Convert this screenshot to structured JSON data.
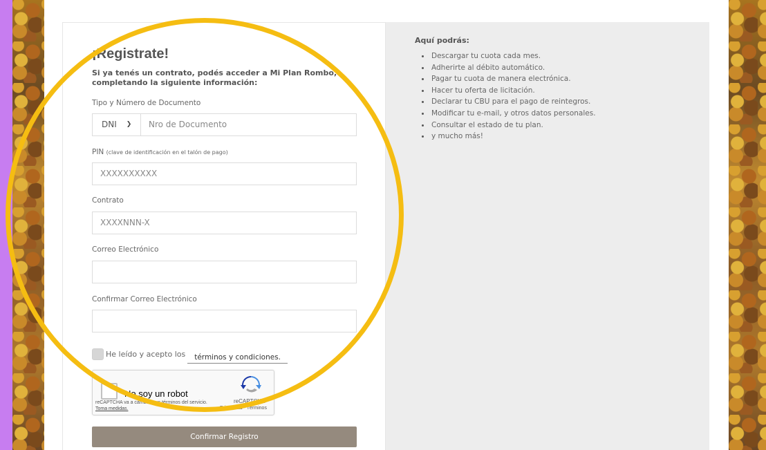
{
  "form": {
    "title": "¡Registrate!",
    "subtitle": "Si ya tenés un contrato, podés acceder a Mi Plan Rombo, completando la siguiente información:",
    "doc_label": "Tipo y Número de Documento",
    "doc_type_value": "DNI",
    "doc_number_placeholder": "Nro de Documento",
    "pin_label": "PIN",
    "pin_hint": "(clave de identificación en el talón de pago)",
    "pin_placeholder": "XXXXXXXXXX",
    "contract_label": "Contrato",
    "contract_placeholder": "XXXXNNN-X",
    "email_label": "Correo Electrónico",
    "email_value": "",
    "confirm_email_label": "Confirmar Correo Electrónico",
    "confirm_email_value": "",
    "terms_text": "He leído y acepto los",
    "terms_link": "términos y condiciones.",
    "submit_label": "Confirmar Registro"
  },
  "recaptcha": {
    "label": "No soy un robot",
    "brand": "reCAPTCHA",
    "legal_prefix": "reCAPTCHA va a cambiar sus términos del servicio.",
    "legal_link": "Toma medidas.",
    "privacy": "Privacidad - Términos"
  },
  "info": {
    "title": "Aquí podrás:",
    "items": [
      "Descargar tu cuota cada mes.",
      "Adherirte al débito automático.",
      "Pagar tu cuota de manera electrónica.",
      "Hacer tu oferta de licitación.",
      "Declarar tu CBU para el pago de reintegros.",
      "Modificar tu e-mail, y otros datos personales.",
      "Consultar el estado de tu plan.",
      "y mucho más!"
    ]
  },
  "colors": {
    "background": "#c77df0",
    "highlight": "#f5bd12",
    "button": "#958a7e",
    "info_panel": "#ededed"
  }
}
